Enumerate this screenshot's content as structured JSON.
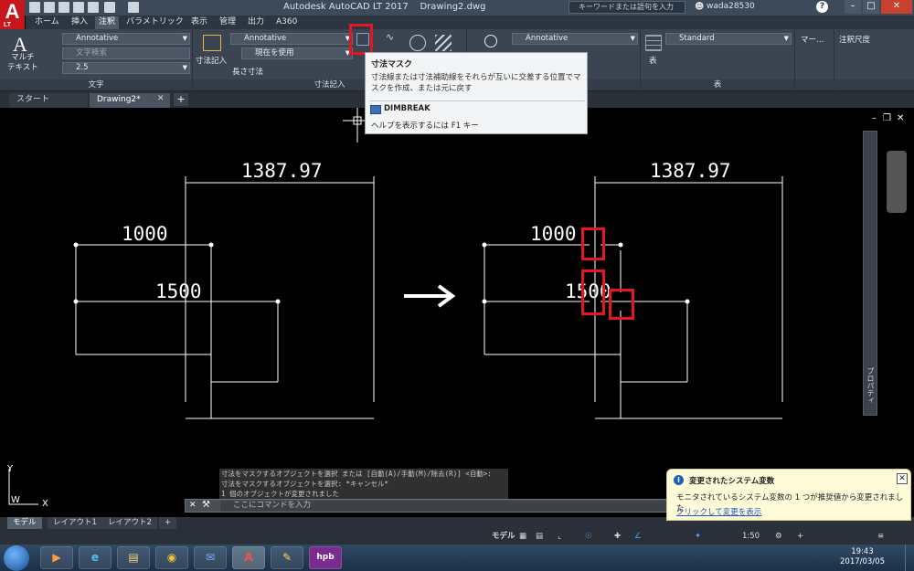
{
  "window": {
    "title": "Autodesk AutoCAD LT 2017    Drawing2.dwg",
    "search_placeholder": "キーワードまたは語句を入力",
    "user": "wada28530",
    "app_logo": "A",
    "app_logo_sub": "LT"
  },
  "ribbon_tabs": [
    {
      "label": "ホーム"
    },
    {
      "label": "挿入"
    },
    {
      "label": "注釈"
    },
    {
      "label": "パラメトリック"
    },
    {
      "label": "表示"
    },
    {
      "label": "管理"
    },
    {
      "label": "出力"
    },
    {
      "label": "A360"
    }
  ],
  "ribbon": {
    "text_panel": {
      "multitext_label": "マルチ\nテキスト",
      "style_value": "Annotative",
      "find_placeholder": "文字検索",
      "height_value": "2.5",
      "title": "文字"
    },
    "dim_panel": {
      "dim_button": "寸法記入",
      "style_value": "Annotative",
      "current_layer": "現在を使用",
      "linear": "長さ寸法",
      "title": "寸法記入"
    },
    "leader_panel": {
      "style_value": "Annotative"
    },
    "table_panel": {
      "table_label": "表",
      "style_value": "Standard",
      "title": "表"
    },
    "markup": "マー…",
    "scale": "注釈尺度"
  },
  "tooltip": {
    "title": "寸法マスク",
    "description": "寸法線または寸法補助線をそれらが互いに交差する位置でマスクを作成、または元に戻す",
    "command": "DIMBREAK",
    "help": "ヘルプを表示するには F1 キー"
  },
  "file_tabs": [
    {
      "label": "スタート"
    },
    {
      "label": "Drawing2*"
    }
  ],
  "drawing": {
    "dim_top": "1387.97",
    "dim_mid": "1000",
    "dim_low": "1500",
    "ucs_y": "Y",
    "ucs_x": "X",
    "ucs_w": "W"
  },
  "palette": {
    "label": "プロパティ"
  },
  "command": {
    "history": [
      "寸法をマスクするオブジェクトを選択 または [自動(A)/手動(M)/除去(R)] <自動>:",
      "寸法をマスクするオブジェクトを選択: *キャンセル*",
      "1 個のオブジェクトが変更されました"
    ],
    "placeholder": "ここにコマンドを入力"
  },
  "layout_tabs": [
    {
      "label": "モデル"
    },
    {
      "label": "レイアウト1"
    },
    {
      "label": "レイアウト2"
    }
  ],
  "statusbar": {
    "model": "モデル",
    "scale": "1:50"
  },
  "notification": {
    "title": "変更されたシステム変数",
    "body": "モニタされているシステム変数の 1 つが推奨値から変更されました",
    "link": "クリックして変更を表示"
  },
  "taskbar": {
    "time": "19:43",
    "date": "2017/03/05",
    "app_label": "hpb"
  },
  "colors": {
    "highlight": "#e5161f",
    "canvas": "#000000",
    "lines": "#ffffff"
  }
}
